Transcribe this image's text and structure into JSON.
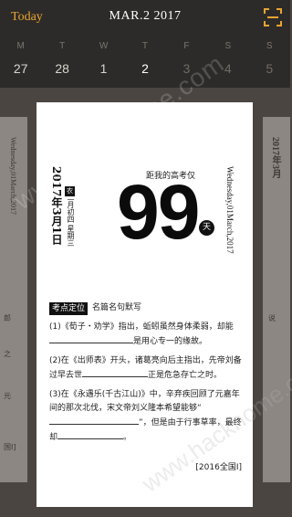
{
  "header": {
    "today_label": "Today",
    "month_title": "MAR.2 2017"
  },
  "weekdays": [
    "M",
    "T",
    "W",
    "T",
    "F",
    "S",
    "S"
  ],
  "days": [
    {
      "num": "27",
      "state": "normal"
    },
    {
      "num": "28",
      "state": "normal"
    },
    {
      "num": "1",
      "state": "normal"
    },
    {
      "num": "2",
      "state": "selected"
    },
    {
      "num": "3",
      "state": "muted"
    },
    {
      "num": "4",
      "state": "muted"
    },
    {
      "num": "5",
      "state": "muted"
    }
  ],
  "card": {
    "date_vertical": "2017年3月1日",
    "lunar_badge": "农",
    "lunar_date": "二月初四",
    "weekday": "星期三",
    "countdown_label": "距我的高考仅",
    "countdown_number": "99",
    "day_unit": "天",
    "english_date": "Wednesday,01March,2017",
    "section_tag": "考点定位",
    "section_title": "名篇名句默写",
    "q1_pre": "(1)《荀子・劝学》指出，蚯蚓虽然身体柔弱，却能",
    "q1_post": "是用心专一的缘故。",
    "q2_pre": "(2)在《出师表》开头，诸葛亮向后主指出，先帝刘备过早去世",
    "q2_post": "正是危急存亡之时。",
    "q3_pre": "(3)在《永遇乐(千古江山)》中，辛弃疾回顾了元嘉年间的那次北伐，宋文帝刘义隆本希望能够“",
    "q3_mid": "”，但是由于行事草率，最终却",
    "q3_post": "。",
    "source": "[2016全国Ⅰ]"
  },
  "side_left": {
    "english": "Wednesday,01March,2017",
    "frag1": "郎",
    "frag2": "之",
    "frag3": "元",
    "frag4": "国Ⅰ]"
  },
  "side_right": {
    "date": "2017年3月",
    "frag1": "说"
  },
  "watermark": "www.hackhome.com",
  "colors": {
    "accent": "#f0a21b",
    "header_bg": "#2d2b29"
  }
}
